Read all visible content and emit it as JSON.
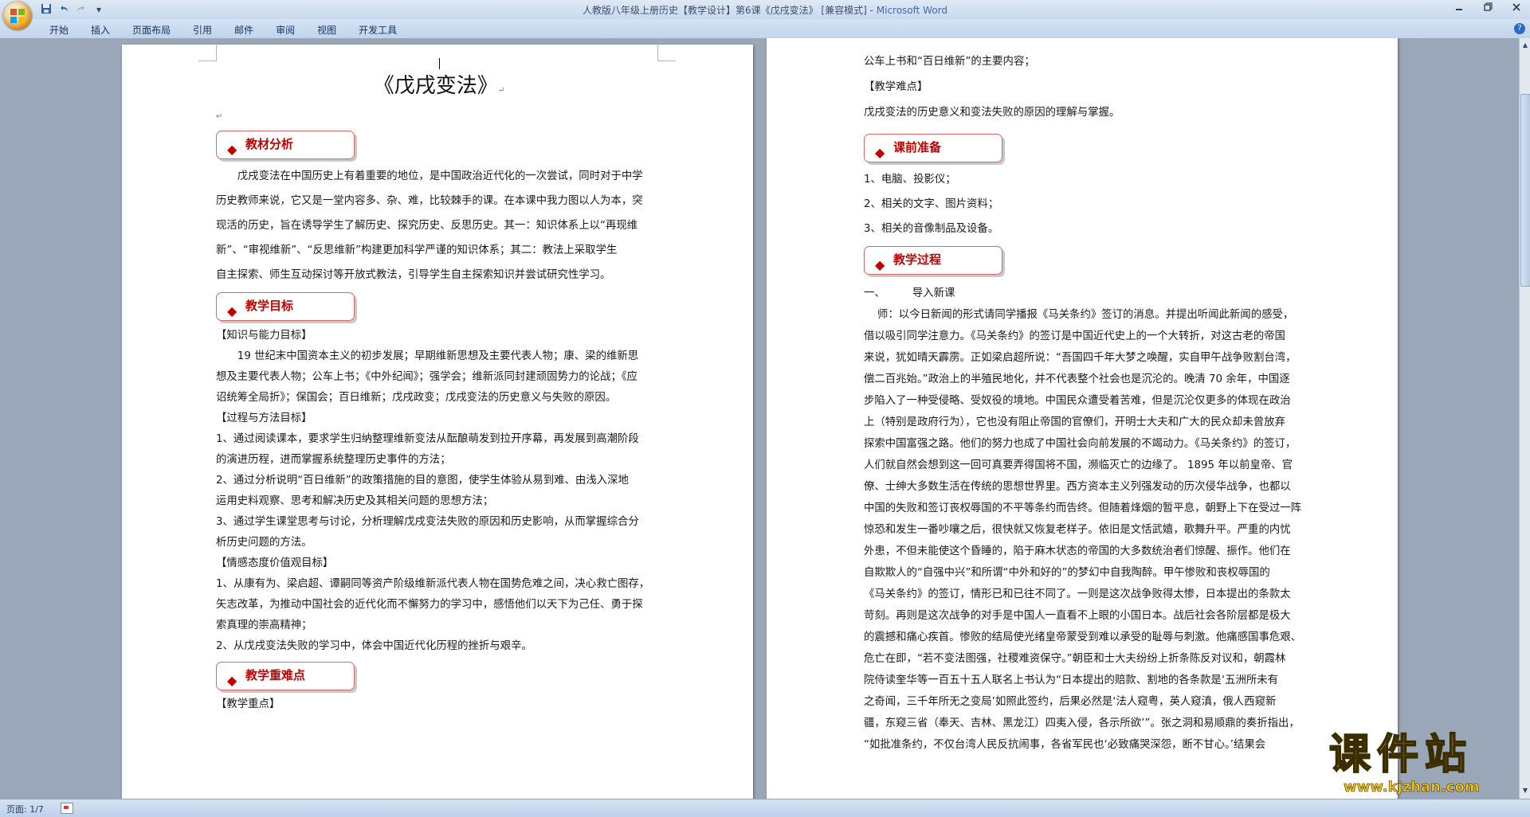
{
  "window": {
    "title": "人教版八年级上册历史【教学设计】第6课《戊戌变法》 [兼容模式] - ",
    "app_name": "Microsoft Word"
  },
  "quick_access": {
    "save": "save-icon",
    "undo": "undo-icon",
    "redo": "redo-icon",
    "customize": "▾"
  },
  "ribbon": {
    "tabs": [
      "开始",
      "插入",
      "页面布局",
      "引用",
      "邮件",
      "审阅",
      "视图",
      "开发工具"
    ]
  },
  "page1": {
    "title": "《戊戌变法》",
    "sections": {
      "s1": "教材分析",
      "s2": "教学目标",
      "s3": "教学重难点"
    },
    "para1": [
      "戊戌变法在中国历史上有着重要的地位，是中国政治近代化的一次尝试，同时对于中学",
      "历史教师来说，它又是一堂内容多、杂、难，比较棘手的课。在本课中我力图以人为本，突",
      "现活的历史，旨在诱导学生了解历史、探究历史、反思历史。其一：知识体系上以“再现维",
      "新”、“审视维新”、“反思维新”构建更加科学严谨的知识体系；其二：教法上采取学生",
      "自主探索、师生互动探讨等开放式教法，引导学生自主探索知识并尝试研究性学习。"
    ],
    "goals_heading_1": "【知识与能力目标】",
    "goals_1": [
      "19 世纪末中国资本主义的初步发展；早期维新思想及主要代表人物；康、梁的维新思",
      "想及主要代表人物；公车上书；《中外纪闻》；强学会；维新派同封建顽固势力的论战；《应",
      "诏统筹全局折》；保国会；百日维新；戊戌政变；戊戌变法的历史意义与失败的原因。"
    ],
    "goals_heading_2": "【过程与方法目标】",
    "goals_2": [
      "1、通过阅读课本，要求学生归纳整理维新变法从酝酿萌发到拉开序幕，再发展到高潮阶段",
      "的演进历程，进而掌握系统整理历史事件的方法；",
      "2、通过分析说明“百日维新”的政策措施的目的意图，使学生体验从易到难、由浅入深地",
      "运用史料观察、思考和解决历史及其相关问题的思想方法；",
      "3、通过学生课堂思考与讨论，分析理解戊戌变法失败的原因和历史影响，从而掌握综合分",
      "析历史问题的方法。"
    ],
    "goals_heading_3": "【情感态度价值观目标】",
    "goals_3": [
      "1、从康有为、梁启超、谭嗣同等资产阶级维新派代表人物在国势危难之间，决心救亡图存，",
      "矢志改革，为推动中国社会的近代化而不懈努力的学习中，感悟他们以天下为己任、勇于探",
      "索真理的崇高精神；",
      "2、从戊戌变法失败的学习中，体会中国近代化历程的挫折与艰辛。"
    ],
    "focus_heading": "【教学重点】"
  },
  "page2": {
    "top_lines": [
      "公车上书和“百日维新”的主要内容；",
      "【教学难点】",
      "戊戌变法的历史意义和变法失败的原因的理解与掌握。"
    ],
    "sections": {
      "s4": "课前准备",
      "s5": "教学过程"
    },
    "prep": [
      "1、电脑、投影仪；",
      "2、相关的文字、图片资料；",
      "3、相关的音像制品及设备。"
    ],
    "step1": "一、        导入新课",
    "body": [
      "    师：以今日新闻的形式请同学播报《马关条约》签订的消息。并提出听闻此新闻的感受，",
      "借以吸引同学注意力。《马关条约》的签订是中国近代史上的一个大转折，对这古老的帝国",
      "来说，犹如晴天霹雳。正如梁启超所说：“吾国四千年大梦之唤醒，实自甲午战争败割台湾，",
      "偿二百兆始。”政治上的半殖民地化，并不代表整个社会也是沉沦的。晚清 70 余年，中国逐",
      "步陷入了一种受侵略、受奴役的境地。中国民众遭受着苦难，但是沉沦仅更多的体现在政治",
      "上（特别是政府行为），它也没有阻止帝国的官僚们，开明士大夫和广大的民众却未曾放弃",
      "探索中国富强之路。他们的努力也成了中国社会向前发展的不竭动力。《马关条约》的签订，",
      "人们就自然会想到这一回可真要弄得国将不国，濒临灭亡的边缘了。 1895 年以前皇帝、官",
      "僚、士绅大多数生活在传统的思想世界里。西方资本主义列强发动的历次侵华战争，也都以",
      "中国的失败和签订丧权辱国的不平等条约而告终。但随着烽烟的暂平息，朝野上下在受过一阵",
      "惊恐和发生一番吵嚷之后，很快就又恢复老样子。依旧是文恬武嬉，歌舞升平。严重的内忧",
      "外患，不但未能使这个昏睡的，陷于麻木状态的帝国的大多数统治者们惊醒、振作。他们在",
      "自欺欺人的“自强中兴”和所谓“中外和好的”的梦幻中自我陶醉。甲午惨败和丧权辱国的",
      "《马关条约》的签订，情形已和已往不同了。一则是这次战争败得太惨，日本提出的条款太",
      "苛刻。再则是这次战争的对手是中国人一直看不上眼的小国日本。战后社会各阶层都是极大",
      "的震撼和痛心疾首。惨败的结局使光绪皇帝蒙受到难以承受的耻辱与刺激。他痛感国事危艰、",
      "危亡在即，“若不变法图强，社稷难资保守。”朝臣和士大夫纷纷上折条陈反对议和，朝霞林",
      "院侍读奎华等一百五十五人联名上书认为“日本提出的赔款、割地的各条款是‘五洲所未有",
      "之奇闻，三千年所无之变局’如照此签约，后果必然是‘法人窥粤，英人窥滇，俄人西窥新",
      "疆，东窥三省（奉天、吉林、黑龙江）四夷入侵，各示所欲’”。张之洞和易顺鼎的奏折指出，",
      "“如批准条约，不仅台湾人民反抗闹事，各省军民也‘必致痛哭深怨，断不甘心。’结果会"
    ]
  },
  "status": {
    "page": "页面: 1/7"
  },
  "watermark": {
    "main": "课件站",
    "url": "www.kjzhan.com"
  },
  "colors": {
    "accent_red": "#c00000",
    "ribbon": "#c9d9ee",
    "background": "#9aa7b8"
  }
}
